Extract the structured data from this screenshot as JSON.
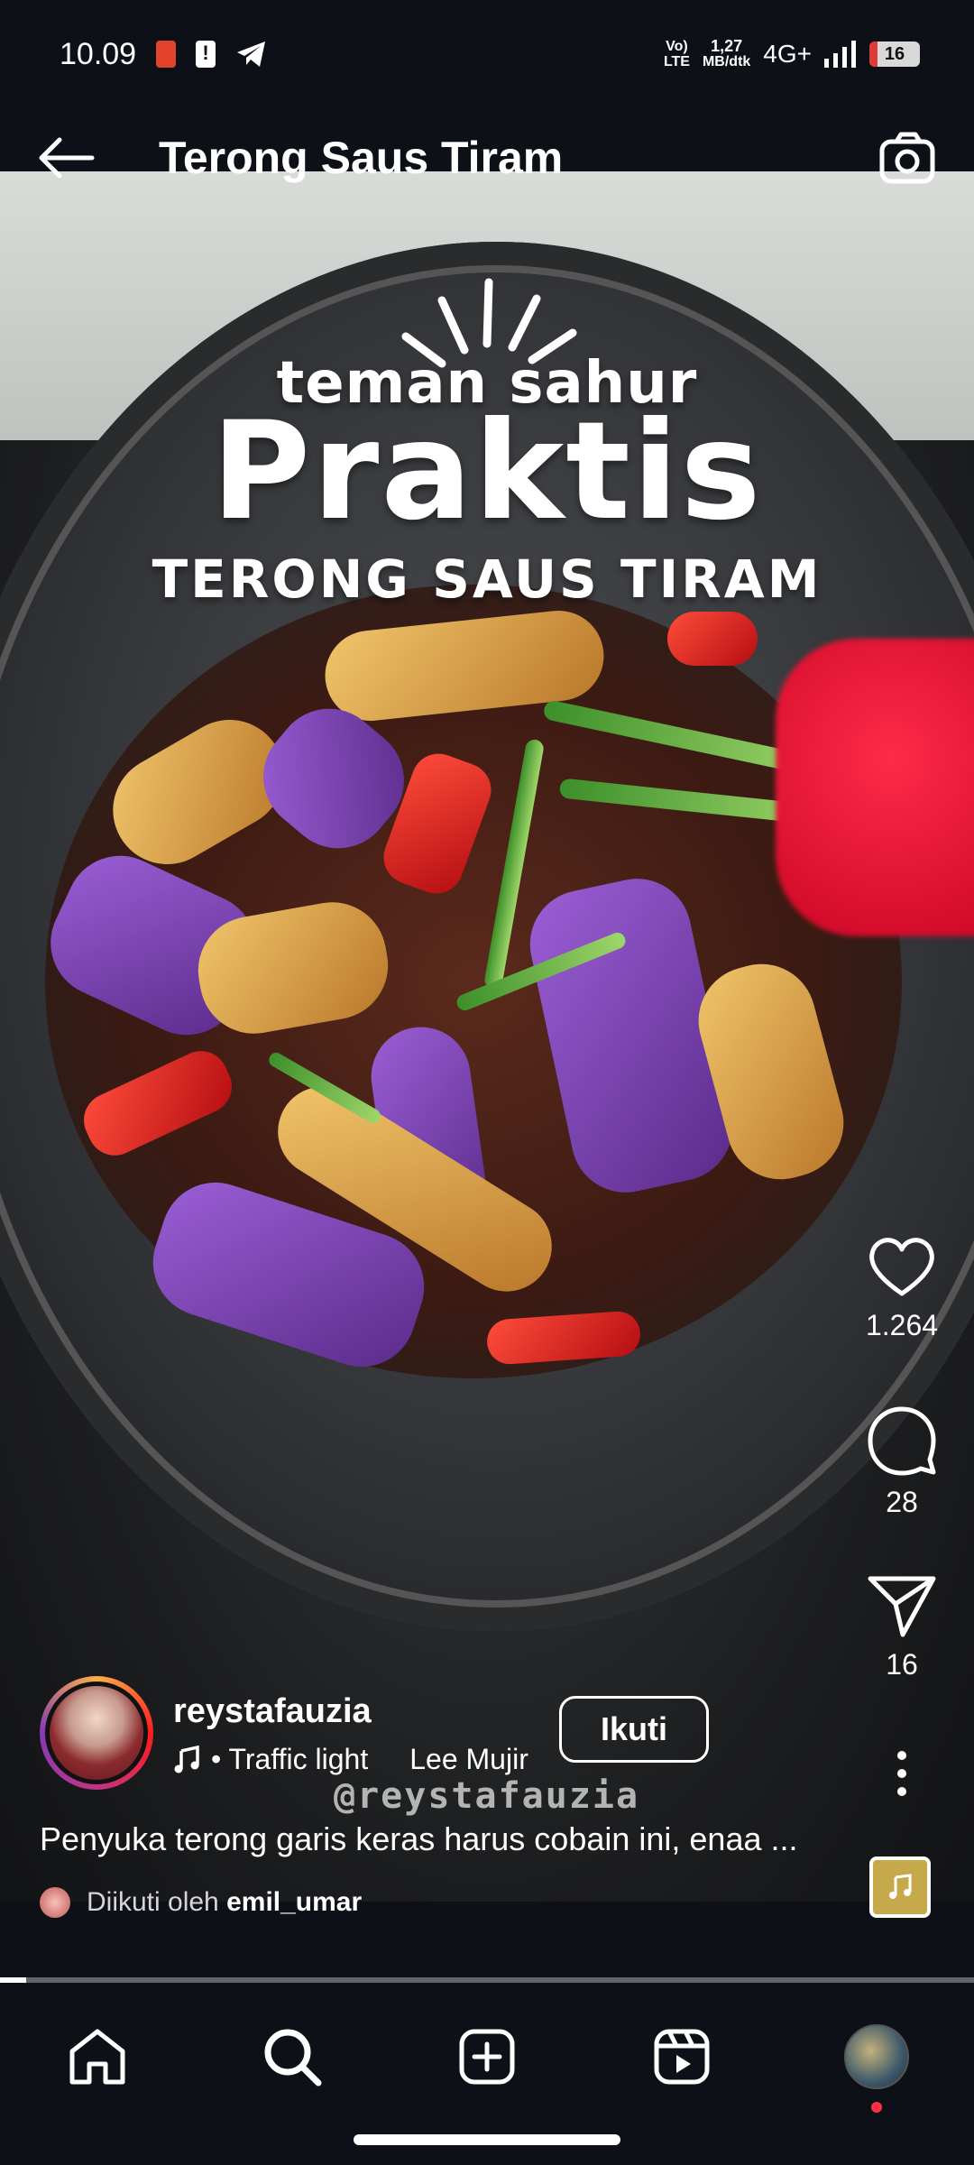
{
  "status_bar": {
    "time": "10.09",
    "network_type_top": "Vo)",
    "network_type_bottom": "LTE",
    "speed_value": "1,27",
    "speed_unit": "MB/dtk",
    "generation": "4G+",
    "battery": "16",
    "battery_level": 0.16
  },
  "header": {
    "title": "Terong Saus Tiram"
  },
  "video_overlay": {
    "line1": "teman sahur",
    "line2": "Praktis",
    "line3": "TERONG SAUS TIRAM",
    "watermark": "@reystafauzia"
  },
  "actions": {
    "likes": "1.264",
    "comments": "28",
    "shares": "16"
  },
  "post": {
    "username": "reystafauzia",
    "music_title": "• Traffic light",
    "music_artist": "Lee Mujir",
    "follow_label": "Ikuti",
    "caption": "Penyuka terong garis keras harus cobain ini, enaa ...",
    "followed_by_prefix": "Diikuti oleh",
    "followed_by_user": "emil_umar"
  },
  "progress": {
    "fraction": 0.027
  },
  "colors": {
    "background": "#0d1117",
    "notification_dot": "#ff3040"
  }
}
